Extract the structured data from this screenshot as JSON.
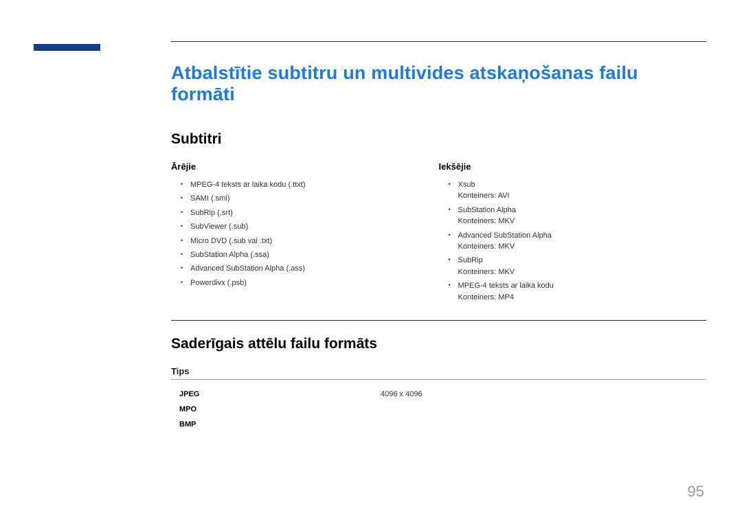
{
  "page": {
    "title": "Atbalstītie subtitru un multivides atskaņošanas failu formāti",
    "number": "95"
  },
  "subtitles": {
    "section_title": "Subtitri",
    "external": {
      "heading": "Ārējie",
      "items": [
        {
          "main": "MPEG-4 teksts ar laika kodu (.ttxt)"
        },
        {
          "main": "SAMI (.smi)"
        },
        {
          "main": "SubRip (.srt)"
        },
        {
          "main": "SubViewer (.sub)"
        },
        {
          "main": "Micro DVD (.sub vai .txt)"
        },
        {
          "main": "SubStation Alpha (.ssa)"
        },
        {
          "main": "Advanced SubStation Alpha (.ass)"
        },
        {
          "main": "Powerdivx (.psb)"
        }
      ]
    },
    "internal": {
      "heading": "Iekšējie",
      "items": [
        {
          "main": "Xsub",
          "sub": "Konteiners: AVI"
        },
        {
          "main": "SubStation Alpha",
          "sub": "Konteiners: MKV"
        },
        {
          "main": "Advanced SubStation Alpha",
          "sub": "Konteiners: MKV"
        },
        {
          "main": "SubRip",
          "sub": "Konteiners: MKV"
        },
        {
          "main": "MPEG-4 teksts ar laika kodu",
          "sub": "Konteiners: MP4"
        }
      ]
    }
  },
  "image_formats": {
    "section_title": "Saderīgais attēlu failu formāts",
    "tips_heading": "Tips",
    "rows": [
      {
        "format": "JPEG",
        "value": "4096 x 4096"
      },
      {
        "format": "MPO",
        "value": ""
      },
      {
        "format": "BMP",
        "value": ""
      }
    ]
  }
}
